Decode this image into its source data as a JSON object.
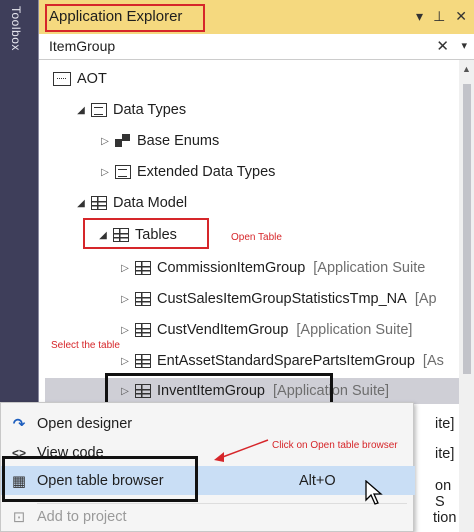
{
  "toolbox": {
    "label": "Toolbox"
  },
  "pane": {
    "title": "Application Explorer",
    "title_icons": [
      "▾",
      "⊥",
      "✕"
    ],
    "search_value": "ItemGroup",
    "search_clear": "✕",
    "search_dropdown": "▾"
  },
  "tree": {
    "aot": "AOT",
    "data_types": "Data Types",
    "base_enums": "Base Enums",
    "extended_data_types": "Extended Data Types",
    "data_model": "Data Model",
    "tables": "Tables",
    "items": [
      {
        "name": "CommissionItemGroup",
        "suite": "[Application Suite"
      },
      {
        "name": "CustSalesItemGroupStatisticsTmp_NA",
        "suite": "[Ap"
      },
      {
        "name": "CustVendItemGroup",
        "suite": "[Application Suite]"
      },
      {
        "name": "EntAssetStandardSparePartsItemGroup",
        "suite": "[As"
      },
      {
        "name": "InventItemGroup",
        "suite": "[Application Suite]"
      }
    ],
    "partial_suffixes": [
      "ite]",
      "ite]",
      "on S",
      "tion"
    ]
  },
  "annotations": {
    "open_table": "Open Table",
    "select_table": "Select the table",
    "click_browser": "Click on Open table browser"
  },
  "menu": {
    "items": [
      {
        "label": "Open designer",
        "shortcut": "",
        "icon": "↷"
      },
      {
        "label": "View code",
        "shortcut": "",
        "icon": "<>"
      },
      {
        "label": "Open table browser",
        "shortcut": "Alt+O",
        "icon": "▦"
      },
      {
        "label": "Add to project",
        "shortcut": "",
        "icon": "⊡"
      }
    ]
  },
  "colors": {
    "title_bg": "#f5d97f",
    "toolbox_bg": "#3e3e5a",
    "highlight": "#c9def5",
    "annotation_red": "#d6262a"
  }
}
